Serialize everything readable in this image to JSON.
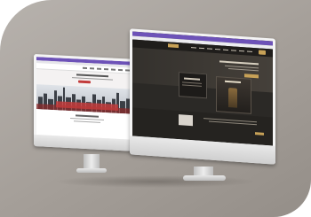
{
  "scene": {
    "description_icon": "desktop-monitor-icon",
    "colors": {
      "wall": "#a8a29c",
      "dark_site_bg": "#2b2926",
      "light_site_bg": "#f2f2f2",
      "accent_red": "#c23b3b",
      "accent_gold": "#c7a157",
      "browser_bar": "#6d52b8"
    }
  }
}
